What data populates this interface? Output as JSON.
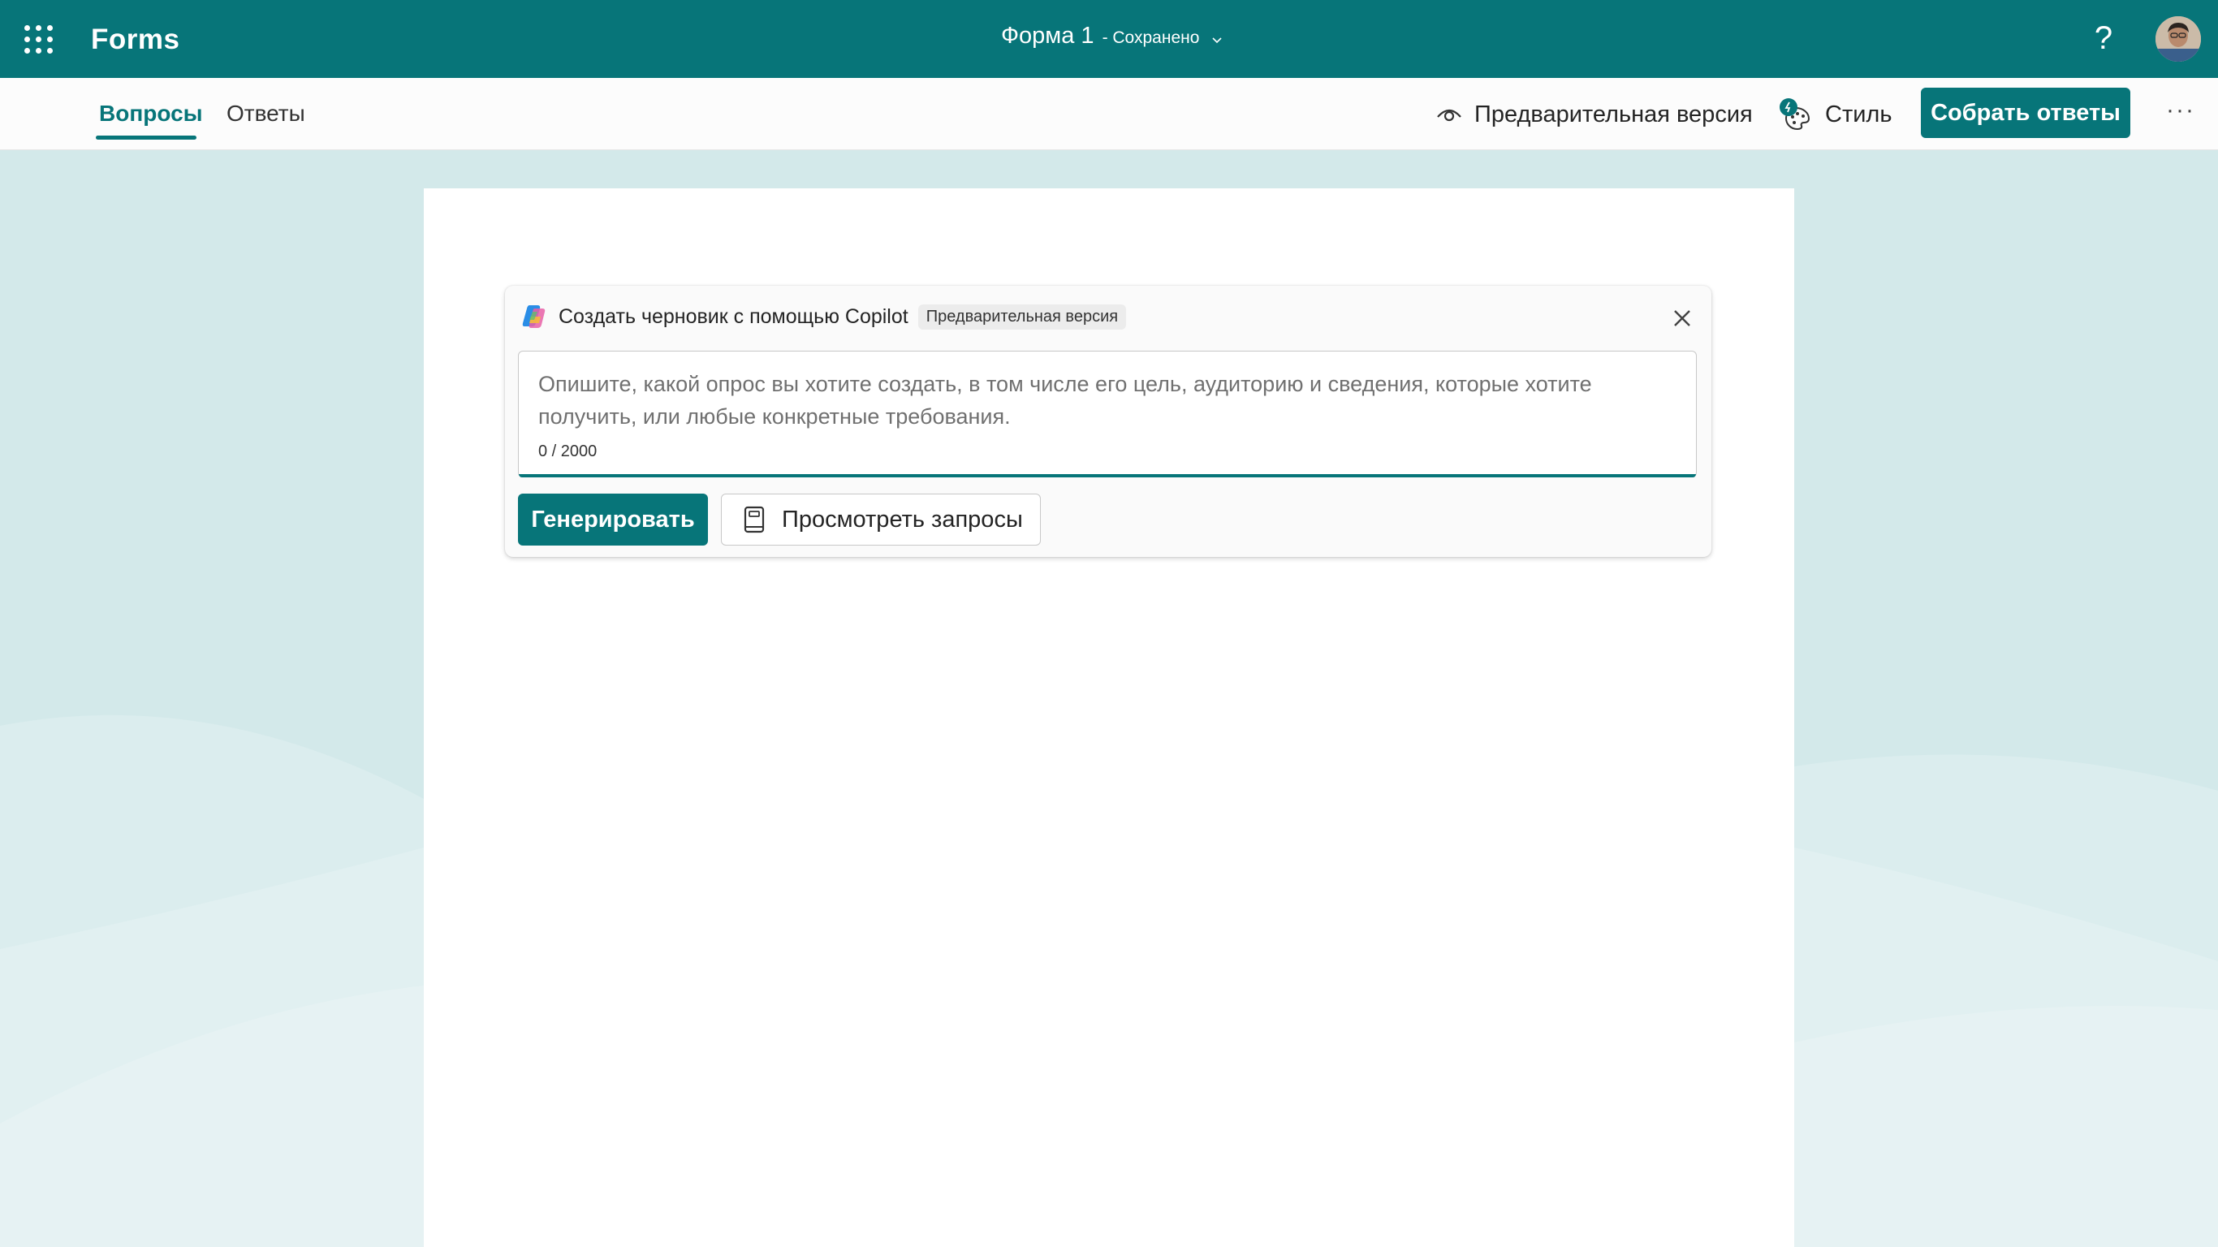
{
  "app": {
    "name": "Forms",
    "form_title": "Форма 1",
    "save_status": "- Сохранено",
    "help_label": "?"
  },
  "tabs": [
    {
      "label": "Вопросы",
      "active": true
    },
    {
      "label": "Ответы",
      "active": false
    }
  ],
  "toolbar": {
    "preview_label": "Предварительная версия",
    "style_label": "Стиль",
    "collect_label": "Собрать ответы",
    "more_label": "···"
  },
  "copilot": {
    "title": "Создать черновик с помощью Copilot",
    "badge": "Предварительная версия",
    "prompt_value": "",
    "prompt_placeholder": "Опишите, какой опрос вы хотите создать, в том числе его цель, аудиторию и сведения, которые хотите получить, или любые конкретные требования.",
    "counter": "0 / 2000",
    "generate_label": "Генерировать",
    "view_prompts_label": "Просмотреть запросы"
  },
  "colors": {
    "brand": "#077579",
    "page_background": "#d3e9ea",
    "canvas": "#ffffff"
  },
  "icons": [
    "waffle-icon",
    "chevron-down-icon",
    "help-icon",
    "avatar",
    "eye-icon",
    "palette-icon",
    "copilot-logo-icon",
    "close-icon",
    "book-icon",
    "more-icon"
  ]
}
